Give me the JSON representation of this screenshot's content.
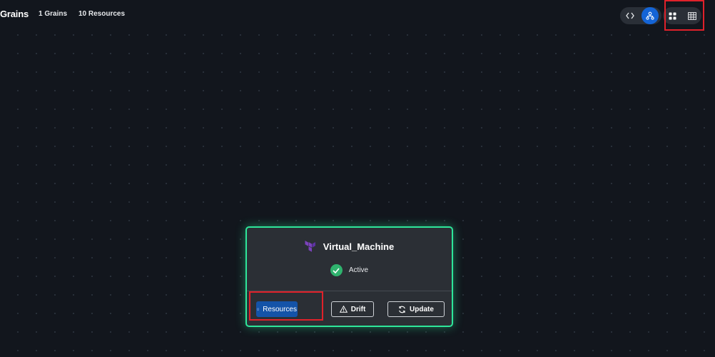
{
  "header": {
    "title": "Grains",
    "grains_count": "1 Grains",
    "resources_count": "10 Resources"
  },
  "toolbar": {
    "view_toggle": {
      "code_icon": "code-icon",
      "graph_icon": "graph-icon",
      "active": "graph"
    },
    "layout_toggle": {
      "grid_icon": "grid-icon",
      "table_icon": "table-icon",
      "active": "grid"
    }
  },
  "grain_card": {
    "name": "Virtual_Machine",
    "provider_icon": "terraform-icon",
    "status": "Active",
    "status_icon": "check-circle-icon",
    "buttons": {
      "resources": "Resources",
      "drift": "Drift",
      "update": "Update"
    }
  },
  "colors": {
    "background": "#12161d",
    "card": "#2b2f35",
    "card_border": "#2ee69a",
    "accent": "#1464d6",
    "status_ok": "#2fb36e",
    "highlight": "#e0212a",
    "terraform": "#7b42bc"
  }
}
